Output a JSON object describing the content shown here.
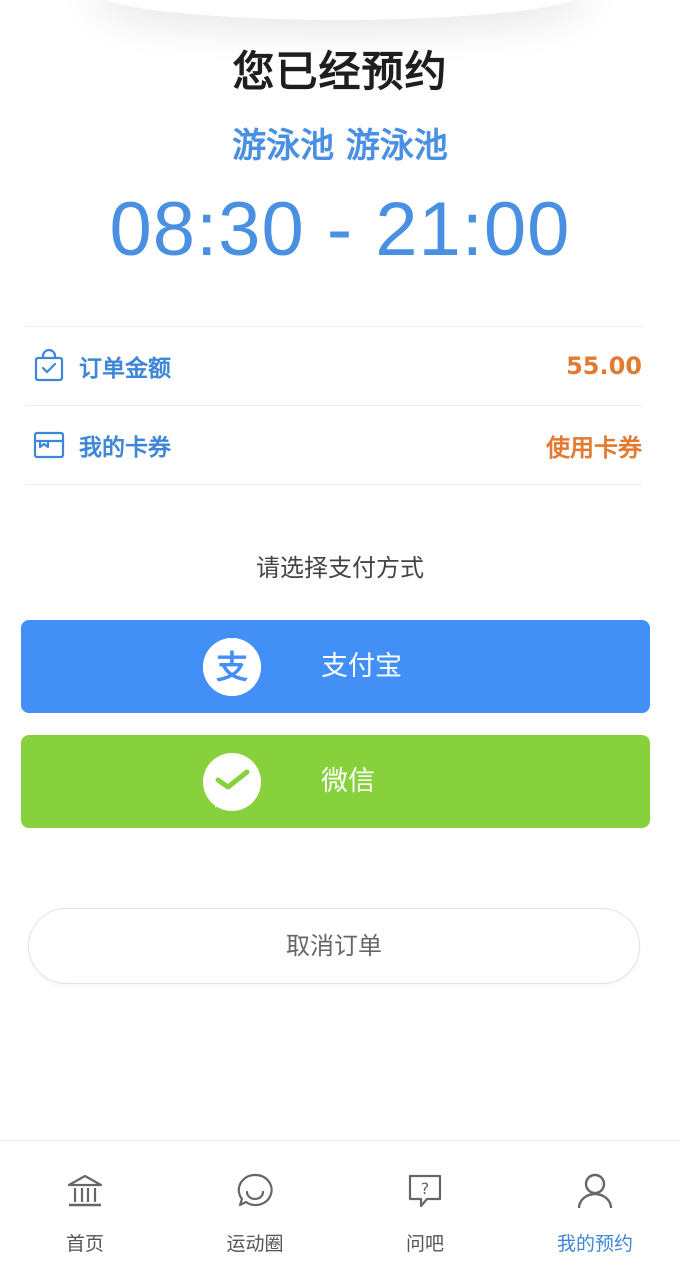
{
  "header": {
    "title": "您已经预约",
    "venue": "游泳池 游泳池",
    "time_range": "08:30 - 21:00"
  },
  "order": {
    "amount_label": "订单金额",
    "amount_value": "55.00",
    "coupon_label": "我的卡券",
    "coupon_action": "使用卡券"
  },
  "payment": {
    "prompt": "请选择支付方式",
    "alipay_label": "支付宝",
    "wechat_label": "微信",
    "alipay_logo_char": "支"
  },
  "cancel_label": "取消订单",
  "tabbar": {
    "items": [
      {
        "label": "首页",
        "icon": "bank-icon"
      },
      {
        "label": "运动圈",
        "icon": "chat-bubble-icon"
      },
      {
        "label": "问吧",
        "icon": "question-icon"
      },
      {
        "label": "我的预约",
        "icon": "user-icon"
      }
    ],
    "active_index": 3
  },
  "colors": {
    "accent_blue": "#4a90e2",
    "orange": "#e37a30",
    "alipay_blue": "#428ff5",
    "wechat_green": "#87d23c"
  }
}
